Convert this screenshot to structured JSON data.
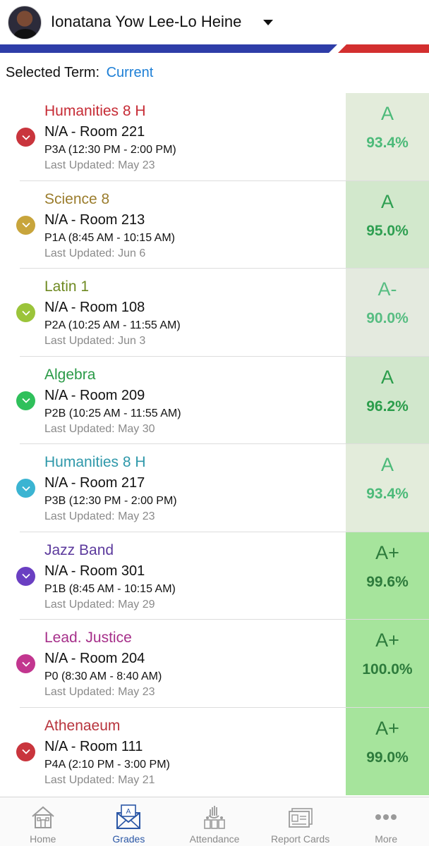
{
  "header": {
    "student_name": "Ionatana Yow Lee-Lo Heine"
  },
  "term": {
    "label": "Selected Term:",
    "value": "Current"
  },
  "courses": [
    {
      "name": "Humanities 8 H",
      "room": "N/A - Room 221",
      "period": "P3A (12:30 PM - 2:00 PM)",
      "updated": "Last Updated: May 23",
      "grade": "A",
      "percent": "93.4%",
      "color": "#c62b35",
      "grade_bg": "#e3ecdb",
      "grade_color": "#4cba79"
    },
    {
      "name": "Science 8",
      "room": "N/A - Room 213",
      "period": "P1A (8:45 AM - 10:15 AM)",
      "updated": "Last Updated: Jun 6",
      "grade": "A",
      "percent": "95.0%",
      "color": "#9b7d2d",
      "grade_bg": "#d2e8cc",
      "grade_color": "#2f9f52"
    },
    {
      "name": "Latin 1",
      "room": "N/A - Room 108",
      "period": "P2A (10:25 AM - 11:55 AM)",
      "updated": "Last Updated: Jun 3",
      "grade": "A-",
      "percent": "90.0%",
      "color": "#6f8a22",
      "grade_bg": "#e4eadf",
      "grade_color": "#57bd82"
    },
    {
      "name": "Algebra",
      "room": "N/A - Room 209",
      "period": "P2B (10:25 AM - 11:55 AM)",
      "updated": "Last Updated: May 30",
      "grade": "A",
      "percent": "96.2%",
      "color": "#2a9a47",
      "grade_bg": "#d1e7cc",
      "grade_color": "#2b9d4b"
    },
    {
      "name": "Humanities 8 H",
      "room": "N/A - Room 217",
      "period": "P3B (12:30 PM - 2:00 PM)",
      "updated": "Last Updated: May 23",
      "grade": "A",
      "percent": "93.4%",
      "color": "#2e98aa",
      "grade_bg": "#e3ecdb",
      "grade_color": "#4cba79"
    },
    {
      "name": "Jazz Band",
      "room": "N/A - Room 301",
      "period": "P1B (8:45 AM - 10:15 AM)",
      "updated": "Last Updated: May 29",
      "grade": "A+",
      "percent": "99.6%",
      "color": "#5c3a9d",
      "grade_bg": "#a6e49c",
      "grade_color": "#2d7b3c"
    },
    {
      "name": "Lead. Justice",
      "room": "N/A - Room 204",
      "period": "P0 (8:30 AM - 8:40 AM)",
      "updated": "Last Updated: May 23",
      "grade": "A+",
      "percent": "100.0%",
      "color": "#a62f8a",
      "grade_bg": "#a6e49c",
      "grade_color": "#2d7b3c"
    },
    {
      "name": "Athenaeum",
      "room": "N/A - Room 111",
      "period": "P4A (2:10 PM - 3:00 PM)",
      "updated": "Last Updated: May 21",
      "grade": "A+",
      "percent": "99.0%",
      "color": "#b8343d",
      "grade_bg": "#a6e49c",
      "grade_color": "#2d7b3c"
    }
  ],
  "chevron_colors": [
    "#c9353d",
    "#c8a53c",
    "#9bc43a",
    "#2fc05b",
    "#3bb4d2",
    "#6a3fc2",
    "#c2368f",
    "#c9353d"
  ],
  "tabs": [
    {
      "label": "Home",
      "icon": "home-icon",
      "active": false
    },
    {
      "label": "Grades",
      "icon": "grades-icon",
      "active": true
    },
    {
      "label": "Attendance",
      "icon": "attendance-icon",
      "active": false
    },
    {
      "label": "Report Cards",
      "icon": "report-cards-icon",
      "active": false
    },
    {
      "label": "More",
      "icon": "more-icon",
      "active": false
    }
  ],
  "colors": {
    "accent_blue": "#2e3da8",
    "accent_red": "#d32f2f",
    "link": "#1d7fd6",
    "tab_active": "#2b57a6",
    "tab_inactive": "#8a8a8a"
  }
}
